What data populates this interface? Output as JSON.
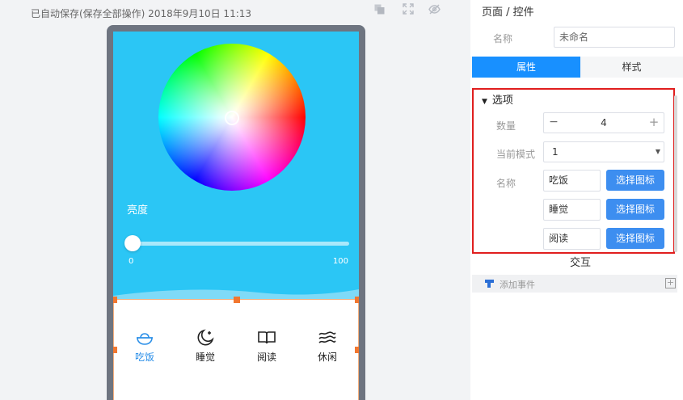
{
  "canvas": {
    "save_status": "已自动保存(保存全部操作) 2018年9月10日 11:13",
    "toolbar": {
      "icons": [
        "copy-icon",
        "fullscreen-icon",
        "hide-icon"
      ]
    }
  },
  "preview": {
    "brightness_label": "亮度",
    "slider": {
      "min": "0",
      "max": "100",
      "value": 0
    },
    "tabs": [
      {
        "label": "吃饭",
        "icon": "rice-bowl-icon",
        "active": true
      },
      {
        "label": "睡觉",
        "icon": "moon-icon",
        "active": false
      },
      {
        "label": "阅读",
        "icon": "book-icon",
        "active": false
      },
      {
        "label": "休闲",
        "icon": "waves-icon",
        "active": false
      }
    ]
  },
  "panel": {
    "title": "页面 / 控件",
    "name_label": "名称",
    "name_value": "未命名",
    "tabs": {
      "attributes": "属性",
      "style": "样式"
    },
    "options": {
      "header": "选项",
      "count_label": "数量",
      "count_value": "4",
      "count_minus": "−",
      "count_plus": "+",
      "mode_label": "当前模式",
      "mode_value": "1",
      "names_label": "名称",
      "names": [
        "吃饭",
        "睡觉",
        "阅读"
      ],
      "pick_icon_label": "选择图标"
    },
    "interaction_label": "交互",
    "add_event_label": "添加事件"
  },
  "colors": {
    "screen_bg": "#2bc6f5",
    "accent": "#1890ff",
    "selection_handle": "#f2772f",
    "highlight_box": "#e01e1e"
  }
}
